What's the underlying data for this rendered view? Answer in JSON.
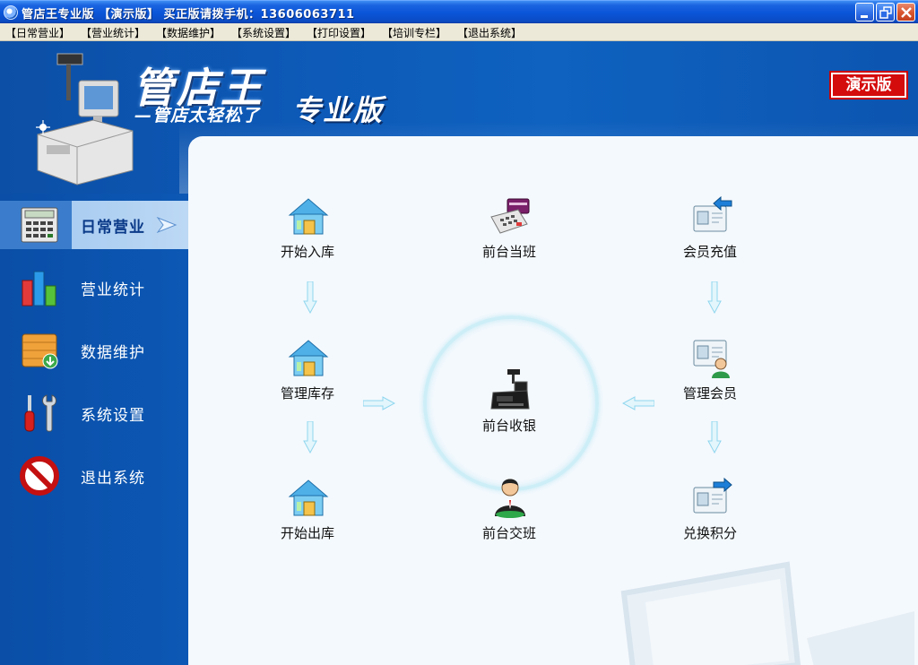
{
  "window": {
    "title": "管店王专业版 【演示版】 买正版请拨手机：13606063711"
  },
  "menu": [
    "【日常营业】",
    "【营业统计】",
    "【数据维护】",
    "【系统设置】",
    "【打印设置】",
    "【培训专栏】",
    "【退出系统】"
  ],
  "header": {
    "logo": "管店王",
    "slogan": "—管店太轻松了",
    "edition": "专业版",
    "demo_badge": "演示版"
  },
  "sidebar": [
    {
      "label": "日常营业",
      "icon": "calculator-icon",
      "active": true
    },
    {
      "label": "营业统计",
      "icon": "bar-chart-icon",
      "active": false
    },
    {
      "label": "数据维护",
      "icon": "crate-icon",
      "active": false
    },
    {
      "label": "系统设置",
      "icon": "tools-icon",
      "active": false
    },
    {
      "label": "退出系统",
      "icon": "no-entry-icon",
      "active": false
    }
  ],
  "workflow": {
    "start_stock_in": "开始入库",
    "manage_inventory": "管理库存",
    "start_stock_out": "开始出库",
    "front_on_duty": "前台当班",
    "front_checkout": "前台收银",
    "front_handover": "前台交班",
    "member_recharge": "会员充值",
    "manage_members": "管理会员",
    "redeem_points": "兑换积分"
  },
  "colors": {
    "titlebar": "#0a55d8",
    "sidebar": "#0c58b4",
    "content_bg": "#f4f9fd",
    "demo_badge": "#d40c0c",
    "arrow": "#8fd6ee"
  }
}
